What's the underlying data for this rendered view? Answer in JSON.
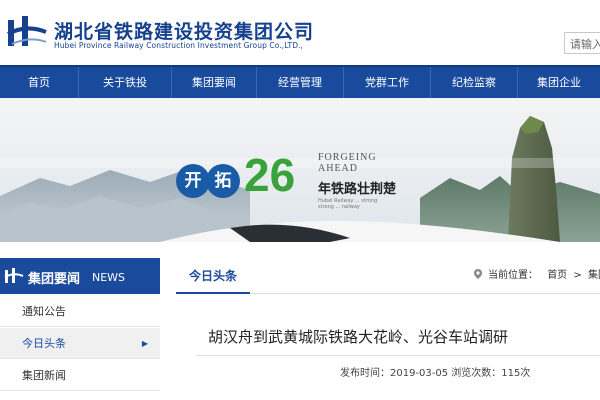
{
  "header": {
    "title": "湖北省铁路建设投资集团公司",
    "subtitle": "Hubei Province Railway Construction Investment Group Co.,LTD.,",
    "search_placeholder": "请输入",
    "brand_color": "#16418f"
  },
  "nav": {
    "items": [
      {
        "label": "首页"
      },
      {
        "label": "关于铁投"
      },
      {
        "label": "集团要闻"
      },
      {
        "label": "经营管理"
      },
      {
        "label": "党群工作"
      },
      {
        "label": "纪检监察"
      },
      {
        "label": "集团企业"
      }
    ],
    "color": "#1a4a9c"
  },
  "banner": {
    "char1": "开",
    "char2": "拓",
    "number": "26",
    "english_line1": "FORGEING",
    "english_line2": "AHEAD",
    "chinese_text": "年铁路壮荆楚",
    "small_line1": "Hubei Railway ... strong",
    "small_line2": "strong ... railway"
  },
  "sidebar": {
    "title": "集团要闻",
    "title_en": "NEWS",
    "items": [
      {
        "label": "通知公告",
        "active": false
      },
      {
        "label": "今日头条",
        "active": true
      },
      {
        "label": "集团新闻",
        "active": false
      }
    ]
  },
  "main": {
    "tab_label": "今日头条",
    "breadcrumb": {
      "prefix": "当前位置：",
      "home": "首页",
      "separator": ">",
      "current": "集团"
    },
    "article": {
      "title": "胡汉舟到武黄城际铁路大花岭、光谷车站调研",
      "meta": "发布时间：2019-03-05 浏览次数：115次"
    }
  }
}
